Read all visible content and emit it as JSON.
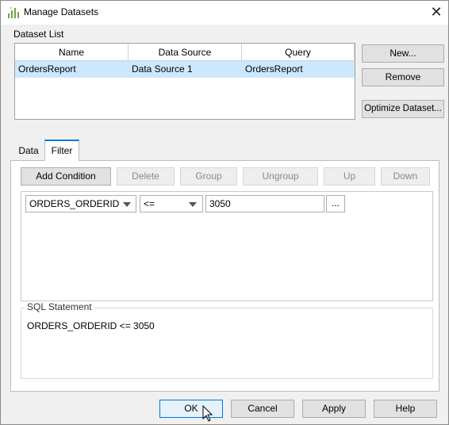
{
  "window": {
    "title": "Manage Datasets",
    "close_glyph": "✕",
    "icon": "dataset-chart-icon"
  },
  "dataset_list": {
    "label": "Dataset List",
    "columns": [
      "Name",
      "Data Source",
      "Query"
    ],
    "rows": [
      {
        "name": "OrdersReport",
        "data_source": "Data Source 1",
        "query": "OrdersReport"
      }
    ]
  },
  "side_buttons": {
    "new": "New...",
    "remove": "Remove",
    "optimize": "Optimize Dataset..."
  },
  "tabs": [
    {
      "label": "Data"
    },
    {
      "label": "Filter"
    }
  ],
  "filter_toolbar": {
    "add_condition": "Add Condition",
    "delete": "Delete",
    "group": "Group",
    "ungroup": "Ungroup",
    "up": "Up",
    "down": "Down"
  },
  "condition": {
    "field": "ORDERS_ORDERID",
    "operator": "<=",
    "value": "3050",
    "more": "..."
  },
  "sql": {
    "label": "SQL Statement",
    "text": "ORDERS_ORDERID <= 3050"
  },
  "footer": {
    "ok": "OK",
    "cancel": "Cancel",
    "apply": "Apply",
    "help": "Help"
  },
  "colors": {
    "accent": "#0078d7",
    "selection": "#cce8ff",
    "icon_green": "#6aa84f"
  }
}
